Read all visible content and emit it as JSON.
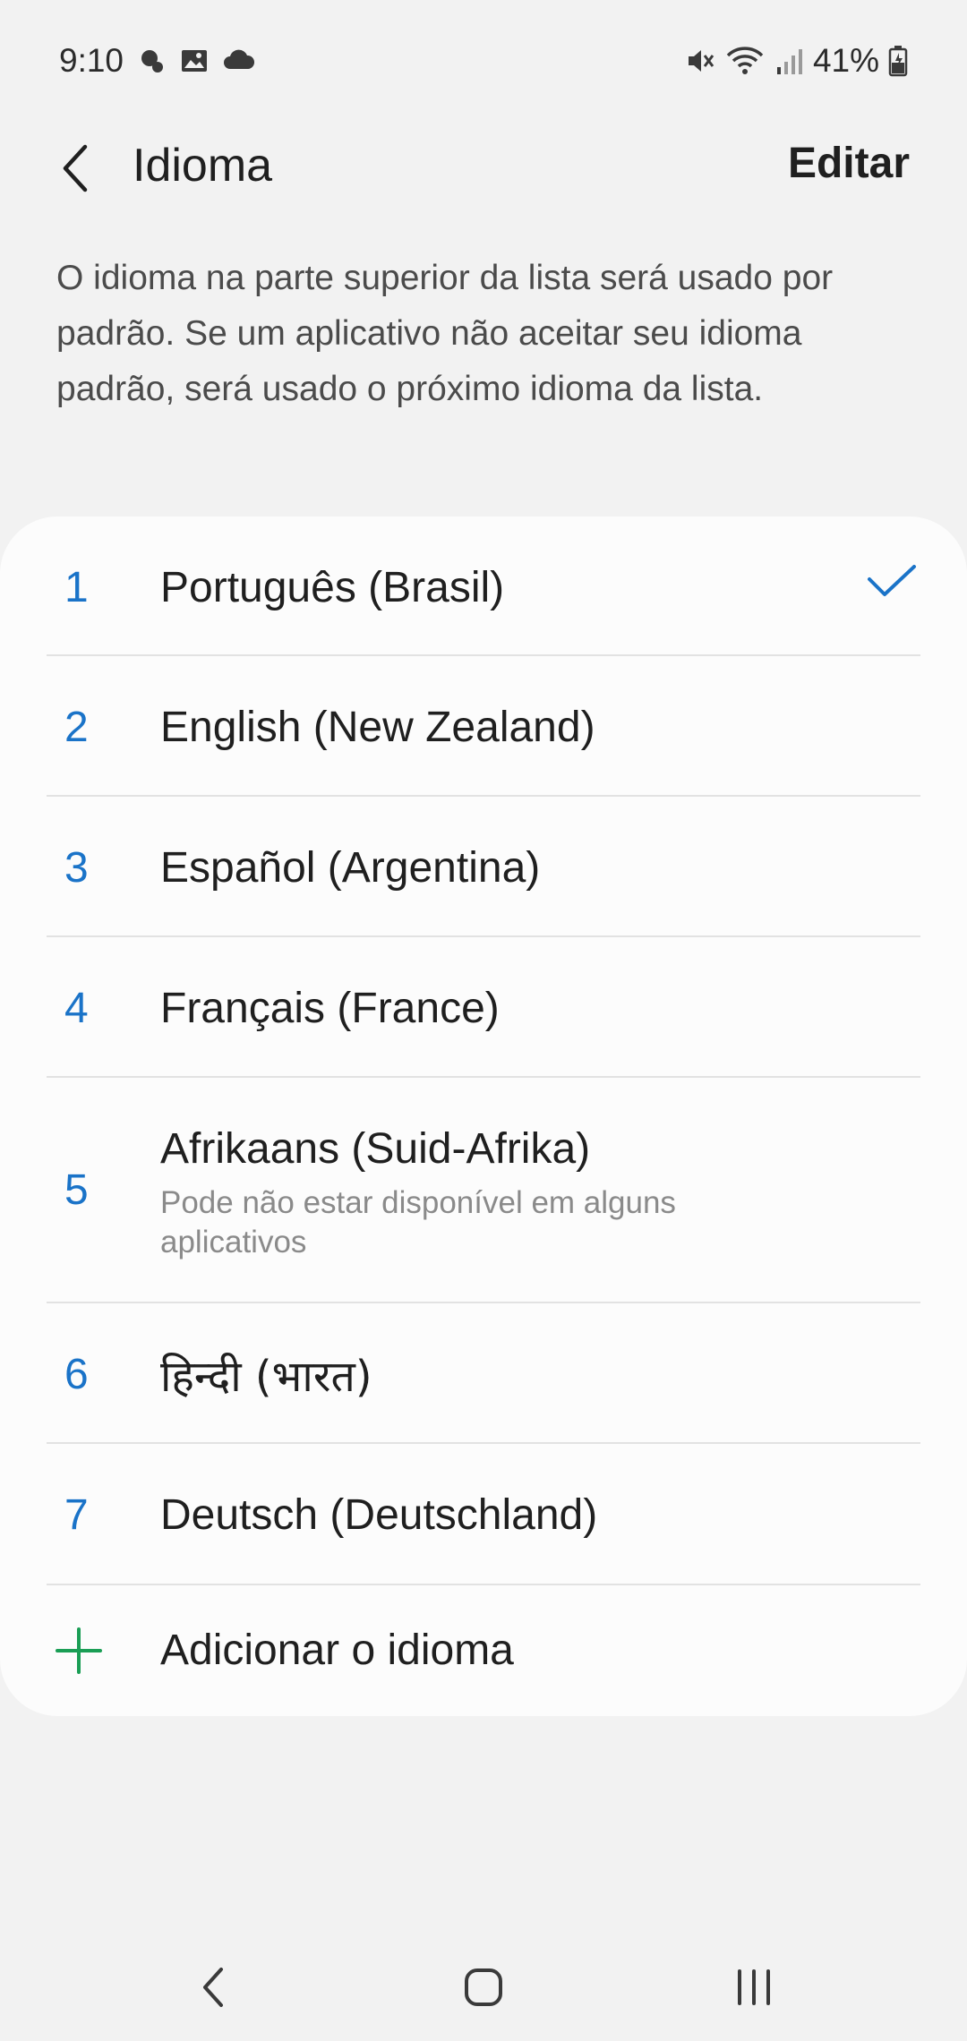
{
  "status_bar": {
    "time": "9:10",
    "battery": "41%",
    "left_icons": [
      "notification-icon",
      "gallery-icon",
      "cloud-icon"
    ],
    "right_icons": [
      "mute-icon",
      "wifi-icon",
      "signal-icon",
      "battery-icon"
    ]
  },
  "header": {
    "title": "Idioma",
    "edit_label": "Editar"
  },
  "description": "O idioma na parte superior da lista será usado por padrão. Se um aplicativo não aceitar seu idioma padrão, será usado o próximo idioma da lista.",
  "languages": [
    {
      "num": "1",
      "label": "Português (Brasil)",
      "selected": true
    },
    {
      "num": "2",
      "label": "English (New Zealand)"
    },
    {
      "num": "3",
      "label": "Español (Argentina)"
    },
    {
      "num": "4",
      "label": "Français (France)"
    },
    {
      "num": "5",
      "label": "Afrikaans (Suid-Afrika)",
      "sub": "Pode não estar disponível em alguns aplicativos"
    },
    {
      "num": "6",
      "label": "हिन्दी (भारत)"
    },
    {
      "num": "7",
      "label": "Deutsch (Deutschland)"
    }
  ],
  "add_language": "Adicionar o idioma",
  "colors": {
    "accent_blue": "#1a73c8",
    "add_green": "#1a9e55",
    "background": "#f2f2f2",
    "card": "#fcfcfc"
  },
  "nav": [
    "back-icon",
    "home-icon",
    "recents-icon"
  ]
}
